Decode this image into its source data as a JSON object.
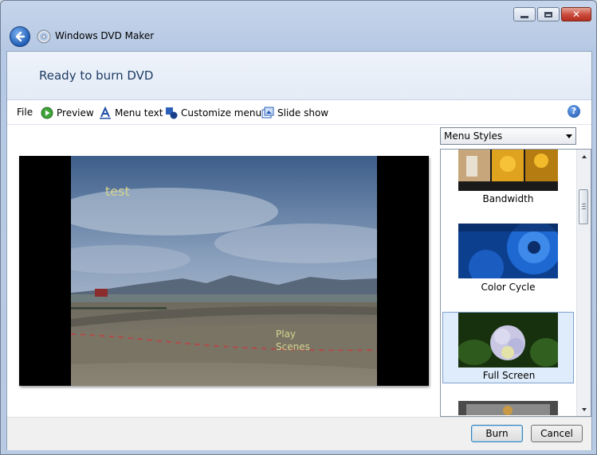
{
  "window": {
    "title": "Windows DVD Maker",
    "caption_buttons": [
      "minimize",
      "maximize",
      "close"
    ]
  },
  "banner": {
    "title": "Ready to burn DVD"
  },
  "toolbar": {
    "file": "File",
    "preview": "Preview",
    "menu_text": "Menu text",
    "customize_menu": "Customize menu",
    "slide_show": "Slide show",
    "icons": [
      "preview-play-icon",
      "menu-text-icon",
      "customize-menu-icon",
      "slide-show-icon",
      "help-icon"
    ]
  },
  "preview": {
    "menu_title": "test",
    "play": "Play",
    "scenes": "Scenes"
  },
  "styles": {
    "dropdown_value": "Menu Styles",
    "items": [
      {
        "label": "Bandwidth"
      },
      {
        "label": "Color Cycle"
      },
      {
        "label": "Full Screen",
        "selected": true
      }
    ]
  },
  "footer": {
    "burn": "Burn",
    "cancel": "Cancel"
  },
  "colors": {
    "menu_text": "#d5d38f",
    "accent": "#1c4fa8",
    "selection": "#dfecfb"
  }
}
